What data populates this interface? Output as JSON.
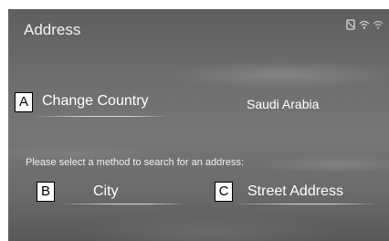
{
  "header": {
    "title": "Address",
    "status_icons": [
      "phone-icon",
      "wifi-icon",
      "signal-icon"
    ]
  },
  "country": {
    "marker": "A",
    "label": "Change Country",
    "value": "Saudi Arabia"
  },
  "search": {
    "prompt": "Please select a method to search for an address:",
    "city": {
      "marker": "B",
      "label": "City"
    },
    "street": {
      "marker": "C",
      "label": "Street Address"
    }
  },
  "colors": {
    "background": "#6e6e6e",
    "text": "#ffffff",
    "marker_bg": "#ffffff",
    "marker_text": "#000000"
  }
}
